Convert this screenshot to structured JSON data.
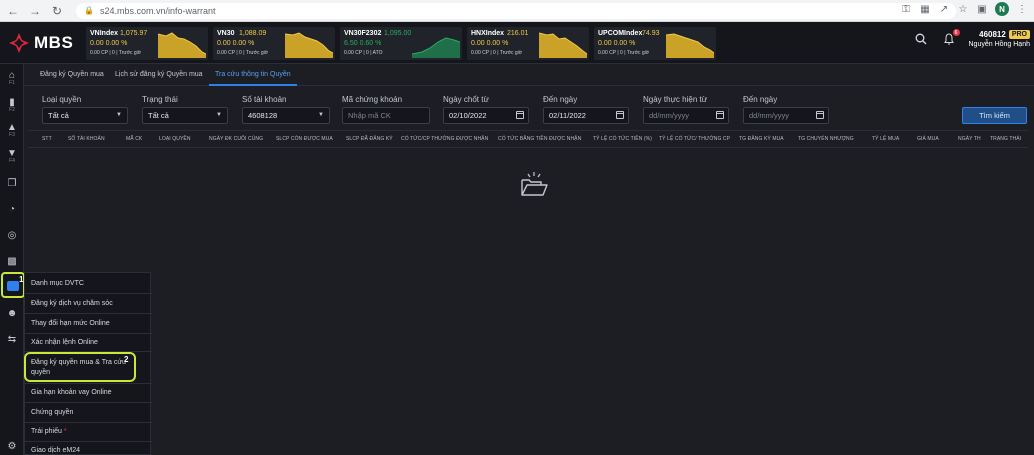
{
  "browser": {
    "url": "s24.mbs.com.vn/info-warrant",
    "profile_initial": "N"
  },
  "header": {
    "logo_text": "MBS",
    "tickers": [
      {
        "name": "VNIndex",
        "value": "1,075.97",
        "change": "0.00  0.00 %",
        "volume": "0.00 CP | 0 | Trước giờ"
      },
      {
        "name": "VN30",
        "value": "1,088.09",
        "change": "0.00  0.00 %",
        "volume": "0.00 CP | 0 | Trước giờ"
      },
      {
        "name": "VN30F2302",
        "value": "1,095.00",
        "change": "6.50  0.60 %",
        "volume": "0.00 CP | 0 | ATO"
      },
      {
        "name": "HNXIndex",
        "value": "216.01",
        "change": "0.00  0.00 %",
        "volume": "0.00 CP | 0 | Trước giờ"
      },
      {
        "name": "UPCOMIndex",
        "value": "74.93",
        "change": "0.00  0.00 %",
        "volume": "0.00 CP | 0 | Trước giờ"
      }
    ],
    "notification_count": "6",
    "account_number": "460812",
    "account_badge": "PRO",
    "account_name": "Nguyễn Hồng Hạnh"
  },
  "sidebar": {
    "sub_labels": [
      "F1",
      "F2",
      "F3",
      "F4"
    ],
    "annotation": "1"
  },
  "tabs": [
    {
      "label": "Đăng ký Quyền mua"
    },
    {
      "label": "Lịch sử đăng ký Quyền mua"
    },
    {
      "label": "Tra cứu thông tin Quyền"
    }
  ],
  "filters": {
    "loai_quyen": {
      "label": "Loại quyền",
      "value": "Tất cả"
    },
    "trang_thai": {
      "label": "Trạng thái",
      "value": "Tất cả"
    },
    "so_tai_khoan": {
      "label": "Số tài khoản",
      "value": "4608128"
    },
    "ma_chung_khoan": {
      "label": "Mã chứng khoán",
      "placeholder": "Nhập mã CK"
    },
    "ngay_chot_tu": {
      "label": "Ngày chốt từ",
      "value": "02/10/2022"
    },
    "den_ngay_1": {
      "label": "Đến ngày",
      "value": "02/11/2022"
    },
    "ngay_thuc_hien_tu": {
      "label": "Ngày thực hiện từ",
      "placeholder": "dd/mm/yyyy"
    },
    "den_ngay_2": {
      "label": "Đến ngày",
      "placeholder": "dd/mm/yyyy"
    },
    "search_label": "Tìm kiếm"
  },
  "table": {
    "columns": [
      "STT",
      "SỐ TÀI KHOẢN",
      "MÃ CK",
      "LOẠI QUYỀN",
      "NGÀY ĐK CUỐI CÙNG",
      "SLCP CÒN ĐƯỢC MUA",
      "SLCP ĐÃ ĐĂNG KÝ",
      "CỔ TỨC/CP THƯỞNG ĐƯỢC NHẬN",
      "CỔ TỨC BẰNG TIỀN ĐƯỢC NHẬN",
      "TỶ LỆ CỔ TỨC TIỀN (%)",
      "TỶ LỆ CỔ TỨC/ THƯỞNG CP",
      "TG ĐĂNG KÝ MUA",
      "TG CHUYỂN NHƯỢNG",
      "TỶ LỆ MUA",
      "GIÁ MUA",
      "NGÀY TH",
      "TRẠNG THÁI"
    ]
  },
  "menu": {
    "items": [
      {
        "label": "Danh mục DVTC"
      },
      {
        "label": "Đăng ký dịch vụ chăm sóc"
      },
      {
        "label": "Thay đổi hạn mức Online"
      },
      {
        "label": "Xác nhận lệnh Online"
      },
      {
        "label": "Đăng ký quyền mua & Tra cứu quyền"
      },
      {
        "label": "Gia hạn khoản vay Online"
      },
      {
        "label": "Chứng quyền"
      },
      {
        "label": "Trái phiếu"
      },
      {
        "label": "Giao dịch eM24"
      }
    ],
    "annotation": "2"
  },
  "colors": {
    "accent": "#2f80ed",
    "up": "#27ae60",
    "ref": "#f2c94c",
    "annotation": "#c7e83b"
  }
}
